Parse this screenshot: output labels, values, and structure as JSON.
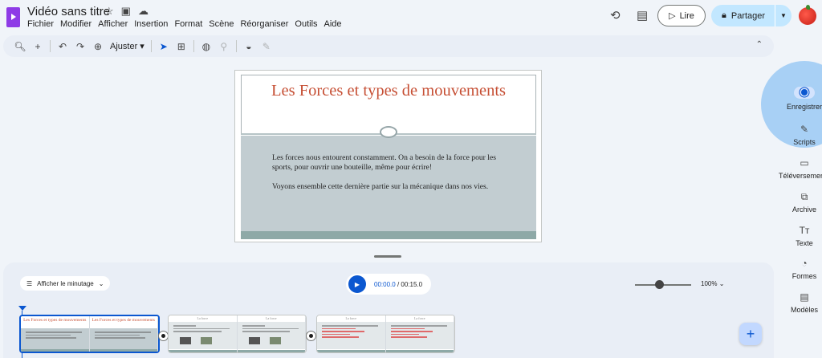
{
  "header": {
    "doc_title": "Vidéo sans titre",
    "menu": [
      "Fichier",
      "Modifier",
      "Afficher",
      "Insertion",
      "Format",
      "Scène",
      "Réorganiser",
      "Outils",
      "Aide"
    ],
    "play_label": "Lire",
    "share_label": "Partager"
  },
  "toolbar": {
    "fit_label": "Ajuster"
  },
  "slide": {
    "title": "Les Forces et types de mouvements",
    "paragraph1": "Les forces nous entourent constamment. On a besoin de la force pour les sports, pour ouvrir une bouteille, même pour écrire!",
    "paragraph2": "Voyons ensemble cette dernière partie sur la mécanique dans nos vies."
  },
  "side_panel": {
    "items": [
      {
        "label": "Enregistrer",
        "icon": "record-icon"
      },
      {
        "label": "Scripts",
        "icon": "script-icon"
      },
      {
        "label": "Téléversements",
        "icon": "folder-icon"
      },
      {
        "label": "Archive",
        "icon": "archive-icon"
      },
      {
        "label": "Texte",
        "icon": "text-icon"
      },
      {
        "label": "Formes",
        "icon": "shapes-icon"
      },
      {
        "label": "Modèles",
        "icon": "templates-icon"
      }
    ]
  },
  "timeline": {
    "timing_label": "Afficher le minutage",
    "current_time": "00:00.0",
    "total_time": "/ 00:15.0",
    "zoom_level": "100%"
  },
  "clips": [
    {
      "thumbs": [
        {
          "title": "Les Forces et types de mouvements"
        },
        {
          "title": "Les Forces et types de mouvements"
        }
      ]
    },
    {
      "thumbs": [
        {
          "title": "La force"
        },
        {
          "title": "La force"
        }
      ]
    },
    {
      "thumbs": [
        {
          "title": "La force"
        },
        {
          "title": "La force"
        }
      ]
    }
  ],
  "colors": {
    "accent": "#0b57d0",
    "title_red": "#c64f34",
    "slide_body": "#c2cdd1",
    "share_bg": "#c2e7ff",
    "brand_purple": "#8e3be6"
  }
}
